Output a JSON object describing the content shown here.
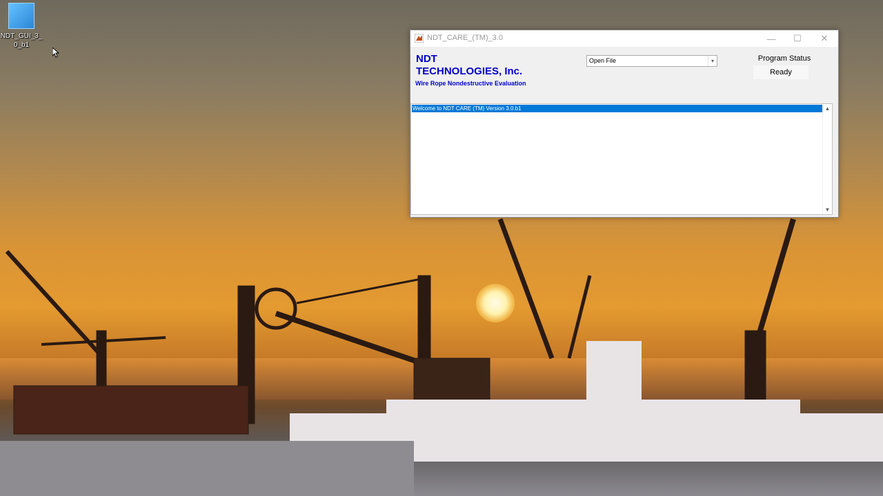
{
  "desktop": {
    "icon_label": "NDT_GUI_3_0_b1"
  },
  "window": {
    "title": "NDT_CARE_(TM)_3.0",
    "controls": {
      "minimize": "—",
      "maximize": "☐",
      "close": "✕"
    }
  },
  "header": {
    "company_line1": "NDT",
    "company_line2": "TECHNOLOGIES, Inc.",
    "tagline": "Wire Rope Nondestructive Evaluation"
  },
  "file_menu": {
    "selected": "Open File"
  },
  "status": {
    "label": "Program Status",
    "value": "Ready"
  },
  "log": {
    "lines": [
      "Welcome to NDT CARE (TM) Version 3.0.b1"
    ]
  },
  "colors": {
    "brand_blue": "#0000c8",
    "selection": "#0078d7"
  }
}
